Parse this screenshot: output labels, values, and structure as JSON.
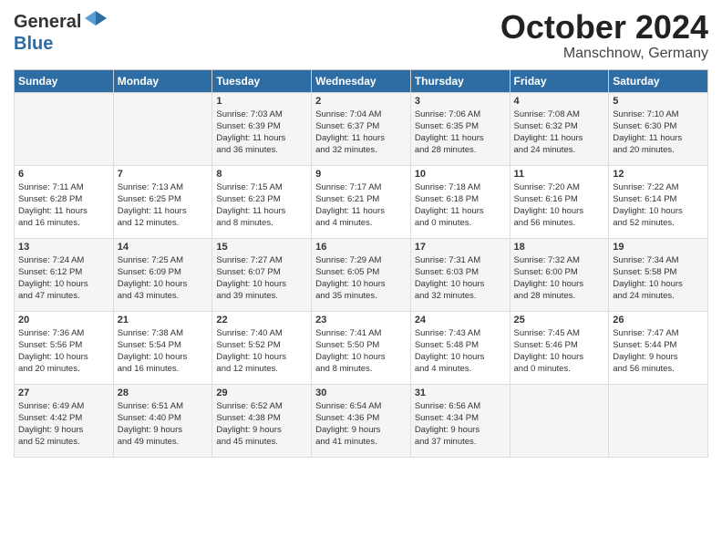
{
  "header": {
    "logo_line1": "General",
    "logo_line2": "Blue",
    "month": "October 2024",
    "location": "Manschnow, Germany"
  },
  "weekdays": [
    "Sunday",
    "Monday",
    "Tuesday",
    "Wednesday",
    "Thursday",
    "Friday",
    "Saturday"
  ],
  "weeks": [
    [
      {
        "day": "",
        "info": ""
      },
      {
        "day": "",
        "info": ""
      },
      {
        "day": "1",
        "info": "Sunrise: 7:03 AM\nSunset: 6:39 PM\nDaylight: 11 hours\nand 36 minutes."
      },
      {
        "day": "2",
        "info": "Sunrise: 7:04 AM\nSunset: 6:37 PM\nDaylight: 11 hours\nand 32 minutes."
      },
      {
        "day": "3",
        "info": "Sunrise: 7:06 AM\nSunset: 6:35 PM\nDaylight: 11 hours\nand 28 minutes."
      },
      {
        "day": "4",
        "info": "Sunrise: 7:08 AM\nSunset: 6:32 PM\nDaylight: 11 hours\nand 24 minutes."
      },
      {
        "day": "5",
        "info": "Sunrise: 7:10 AM\nSunset: 6:30 PM\nDaylight: 11 hours\nand 20 minutes."
      }
    ],
    [
      {
        "day": "6",
        "info": "Sunrise: 7:11 AM\nSunset: 6:28 PM\nDaylight: 11 hours\nand 16 minutes."
      },
      {
        "day": "7",
        "info": "Sunrise: 7:13 AM\nSunset: 6:25 PM\nDaylight: 11 hours\nand 12 minutes."
      },
      {
        "day": "8",
        "info": "Sunrise: 7:15 AM\nSunset: 6:23 PM\nDaylight: 11 hours\nand 8 minutes."
      },
      {
        "day": "9",
        "info": "Sunrise: 7:17 AM\nSunset: 6:21 PM\nDaylight: 11 hours\nand 4 minutes."
      },
      {
        "day": "10",
        "info": "Sunrise: 7:18 AM\nSunset: 6:18 PM\nDaylight: 11 hours\nand 0 minutes."
      },
      {
        "day": "11",
        "info": "Sunrise: 7:20 AM\nSunset: 6:16 PM\nDaylight: 10 hours\nand 56 minutes."
      },
      {
        "day": "12",
        "info": "Sunrise: 7:22 AM\nSunset: 6:14 PM\nDaylight: 10 hours\nand 52 minutes."
      }
    ],
    [
      {
        "day": "13",
        "info": "Sunrise: 7:24 AM\nSunset: 6:12 PM\nDaylight: 10 hours\nand 47 minutes."
      },
      {
        "day": "14",
        "info": "Sunrise: 7:25 AM\nSunset: 6:09 PM\nDaylight: 10 hours\nand 43 minutes."
      },
      {
        "day": "15",
        "info": "Sunrise: 7:27 AM\nSunset: 6:07 PM\nDaylight: 10 hours\nand 39 minutes."
      },
      {
        "day": "16",
        "info": "Sunrise: 7:29 AM\nSunset: 6:05 PM\nDaylight: 10 hours\nand 35 minutes."
      },
      {
        "day": "17",
        "info": "Sunrise: 7:31 AM\nSunset: 6:03 PM\nDaylight: 10 hours\nand 32 minutes."
      },
      {
        "day": "18",
        "info": "Sunrise: 7:32 AM\nSunset: 6:00 PM\nDaylight: 10 hours\nand 28 minutes."
      },
      {
        "day": "19",
        "info": "Sunrise: 7:34 AM\nSunset: 5:58 PM\nDaylight: 10 hours\nand 24 minutes."
      }
    ],
    [
      {
        "day": "20",
        "info": "Sunrise: 7:36 AM\nSunset: 5:56 PM\nDaylight: 10 hours\nand 20 minutes."
      },
      {
        "day": "21",
        "info": "Sunrise: 7:38 AM\nSunset: 5:54 PM\nDaylight: 10 hours\nand 16 minutes."
      },
      {
        "day": "22",
        "info": "Sunrise: 7:40 AM\nSunset: 5:52 PM\nDaylight: 10 hours\nand 12 minutes."
      },
      {
        "day": "23",
        "info": "Sunrise: 7:41 AM\nSunset: 5:50 PM\nDaylight: 10 hours\nand 8 minutes."
      },
      {
        "day": "24",
        "info": "Sunrise: 7:43 AM\nSunset: 5:48 PM\nDaylight: 10 hours\nand 4 minutes."
      },
      {
        "day": "25",
        "info": "Sunrise: 7:45 AM\nSunset: 5:46 PM\nDaylight: 10 hours\nand 0 minutes."
      },
      {
        "day": "26",
        "info": "Sunrise: 7:47 AM\nSunset: 5:44 PM\nDaylight: 9 hours\nand 56 minutes."
      }
    ],
    [
      {
        "day": "27",
        "info": "Sunrise: 6:49 AM\nSunset: 4:42 PM\nDaylight: 9 hours\nand 52 minutes."
      },
      {
        "day": "28",
        "info": "Sunrise: 6:51 AM\nSunset: 4:40 PM\nDaylight: 9 hours\nand 49 minutes."
      },
      {
        "day": "29",
        "info": "Sunrise: 6:52 AM\nSunset: 4:38 PM\nDaylight: 9 hours\nand 45 minutes."
      },
      {
        "day": "30",
        "info": "Sunrise: 6:54 AM\nSunset: 4:36 PM\nDaylight: 9 hours\nand 41 minutes."
      },
      {
        "day": "31",
        "info": "Sunrise: 6:56 AM\nSunset: 4:34 PM\nDaylight: 9 hours\nand 37 minutes."
      },
      {
        "day": "",
        "info": ""
      },
      {
        "day": "",
        "info": ""
      }
    ]
  ]
}
